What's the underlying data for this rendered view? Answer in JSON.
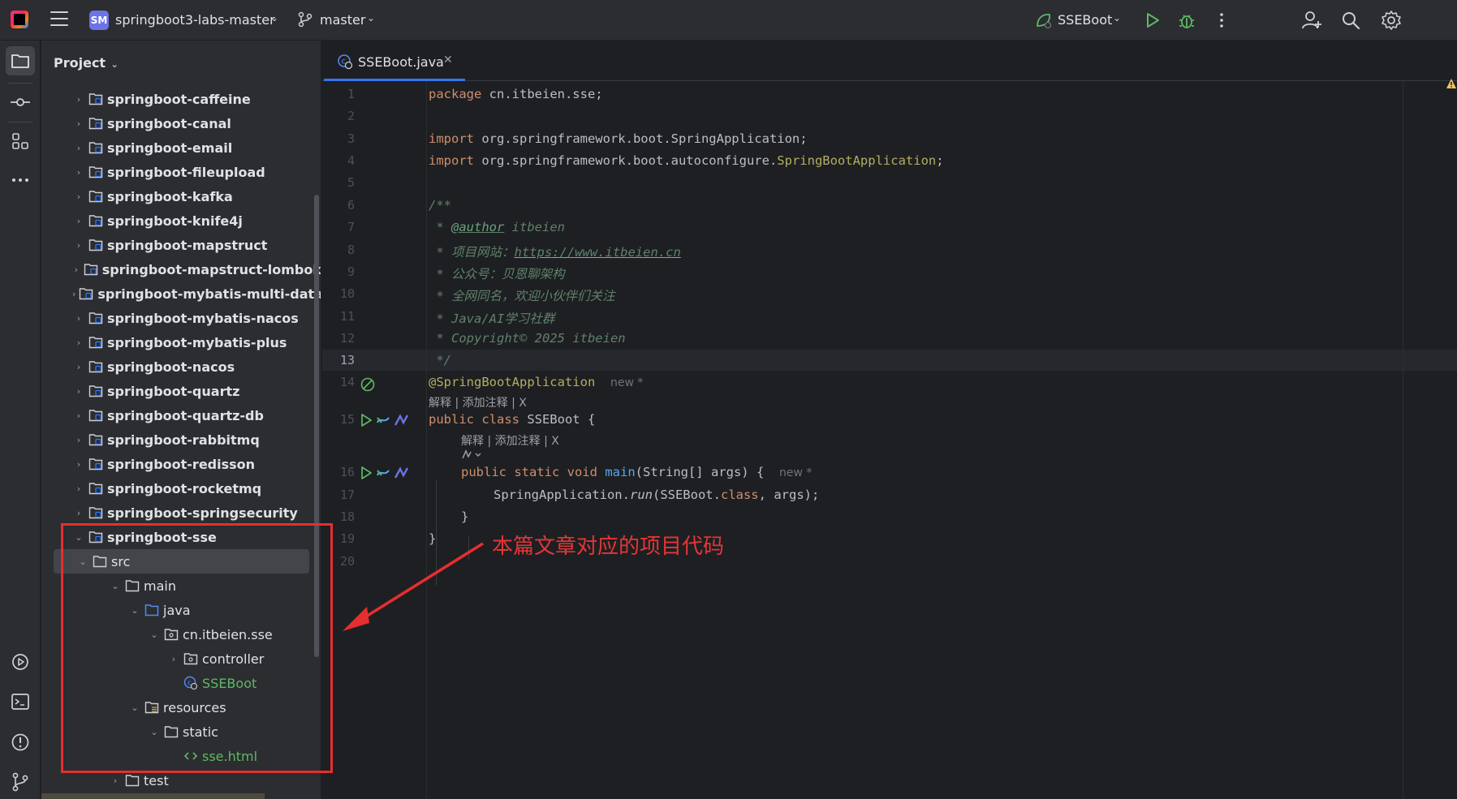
{
  "titlebar": {
    "project_badge": "SM",
    "project_name": "springboot3-labs-master",
    "branch": "master",
    "run_config": "SSEBoot"
  },
  "project_panel": {
    "title": "Project",
    "modules": [
      "springboot-caffeine",
      "springboot-canal",
      "springboot-email",
      "springboot-fileupload",
      "springboot-kafka",
      "springboot-knife4j",
      "springboot-mapstruct",
      "springboot-mapstruct-lombok",
      "springboot-mybatis-multi-datasou",
      "springboot-mybatis-nacos",
      "springboot-mybatis-plus",
      "springboot-nacos",
      "springboot-quartz",
      "springboot-quartz-db",
      "springboot-rabbitmq",
      "springboot-redisson",
      "springboot-rocketmq",
      "springboot-springsecurity"
    ],
    "expanded_module": "springboot-sse",
    "src": "src",
    "main": "main",
    "java": "java",
    "package": "cn.itbeien.sse",
    "controller": "controller",
    "main_class": "SSEBoot",
    "resources": "resources",
    "static": "static",
    "html_file": "sse.html",
    "test": "test"
  },
  "editor": {
    "tab_label": "SSEBoot.java",
    "line_numbers": [
      "1",
      "2",
      "3",
      "4",
      "5",
      "6",
      "7",
      "8",
      "9",
      "10",
      "11",
      "12",
      "13",
      "14",
      "15",
      "16",
      "17",
      "18",
      "19",
      "20"
    ],
    "code": {
      "l1_kw": "package",
      "l1_rest": " cn.itbeien.sse;",
      "l3_kw": "import",
      "l3_rest": " org.springframework.boot.SpringApplication;",
      "l4_kw": "import",
      "l4_rest": " org.springframework.boot.autoconfigure.",
      "l4_cls": "SpringBootApplication",
      "l4_end": ";",
      "l6": "/**",
      "l7_star": " * ",
      "l7_tag": "@author",
      "l7_rest": " itbeien",
      "l8_pre": " * 项目网站：",
      "l8_link": "https://www.itbeien.cn",
      "l9": " * 公众号：贝恩聊架构",
      "l10": " * 全网同名，欢迎小伙伴们关注",
      "l11": " * Java/AI学习社群",
      "l12": " * Copyright© 2025 itbeien",
      "l13": " */",
      "l14_ann": "@SpringBootApplication",
      "l14_hint": "new *",
      "l15_kw": "public class",
      "l15_rest": " SSEBoot {",
      "l16_kw": "public static void",
      "l16_fn": "main",
      "l16_rest": "(String[] args) {",
      "l16_hint": "new *",
      "l17_pre": "SpringApplication.",
      "l17_fn": "run",
      "l17_mid": "(SSEBoot.",
      "l17_kw": "class",
      "l17_end": ", args);",
      "l18": "}",
      "l19": "}"
    },
    "inlay_hint_1": "解释 | 添加注释 | X",
    "inlay_hint_2": "解释 | 添加注释 | X"
  },
  "annotation": {
    "text": "本篇文章对应的项目代码"
  }
}
